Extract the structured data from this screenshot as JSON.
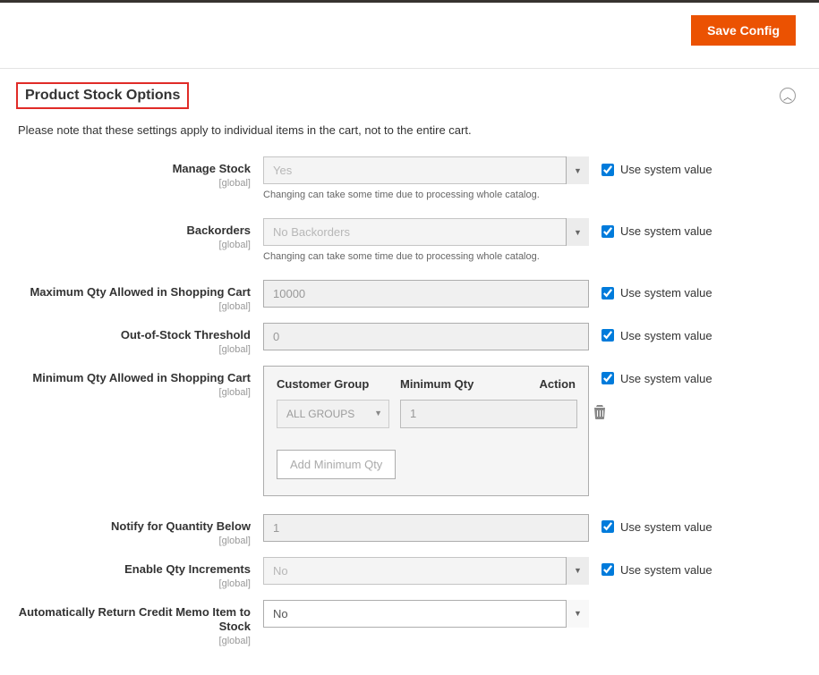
{
  "header": {
    "save_label": "Save Config"
  },
  "section": {
    "title": "Product Stock Options",
    "note": "Please note that these settings apply to individual items in the cart, not to the entire cart."
  },
  "scope_global": "[global]",
  "use_system_value_label": "Use system value",
  "fields": {
    "manage_stock": {
      "label": "Manage Stock",
      "value": "Yes",
      "hint": "Changing can take some time due to processing whole catalog."
    },
    "backorders": {
      "label": "Backorders",
      "value": "No Backorders",
      "hint": "Changing can take some time due to processing whole catalog."
    },
    "max_qty": {
      "label": "Maximum Qty Allowed in Shopping Cart",
      "value": "10000"
    },
    "oos_threshold": {
      "label": "Out-of-Stock Threshold",
      "value": "0"
    },
    "min_qty": {
      "label": "Minimum Qty Allowed in Shopping Cart",
      "col_customer_group": "Customer Group",
      "col_minimum_qty": "Minimum Qty",
      "col_action": "Action",
      "row_group": "ALL GROUPS",
      "row_qty": "1",
      "add_button": "Add Minimum Qty"
    },
    "notify_below": {
      "label": "Notify for Quantity Below",
      "value": "1"
    },
    "qty_increments": {
      "label": "Enable Qty Increments",
      "value": "No"
    },
    "auto_return": {
      "label": "Automatically Return Credit Memo Item to Stock",
      "value": "No"
    }
  }
}
